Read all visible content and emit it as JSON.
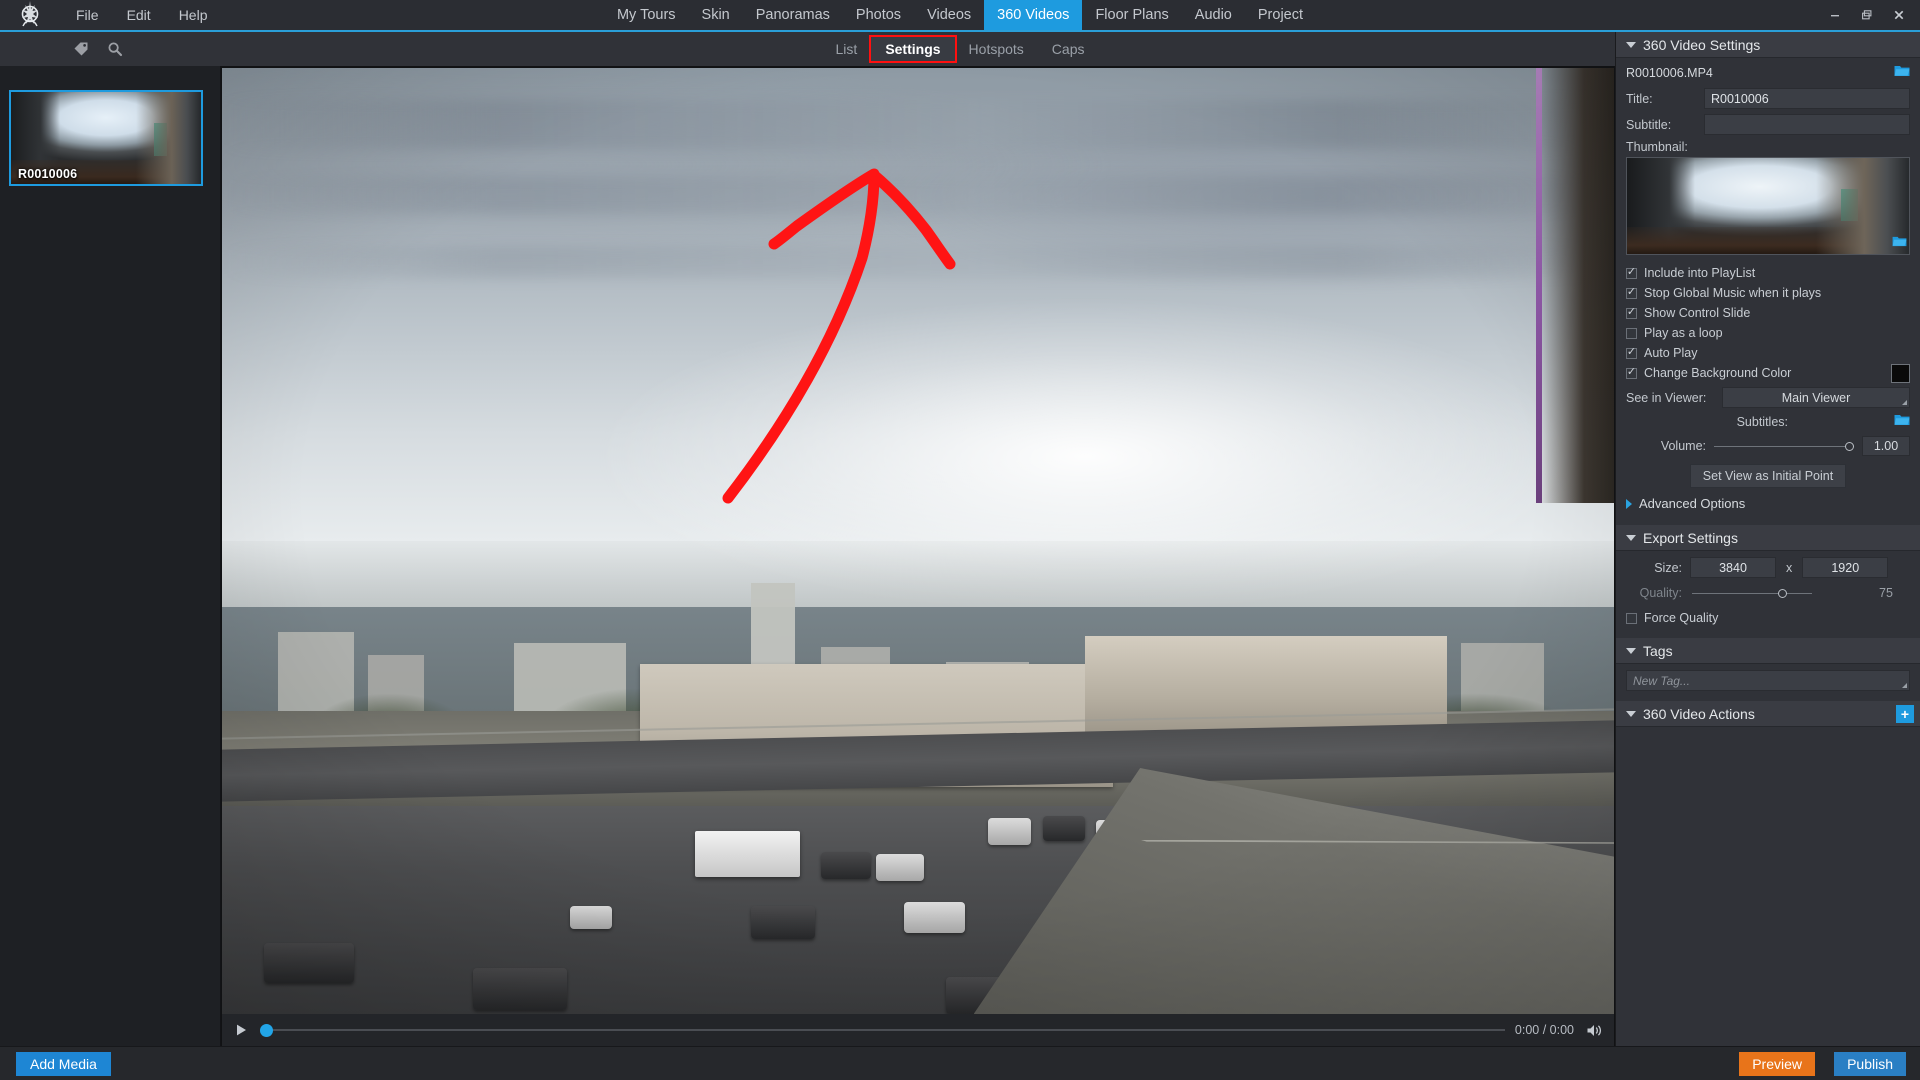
{
  "app": {
    "menus": [
      "File",
      "Edit",
      "Help"
    ],
    "toolbar_icons": [
      "tag-icon",
      "search-icon"
    ],
    "window_controls": {
      "minimize": "—",
      "restore": "❐",
      "close": "✕"
    }
  },
  "main_tabs": [
    {
      "label": "My Tours",
      "active": false
    },
    {
      "label": "Skin",
      "active": false
    },
    {
      "label": "Panoramas",
      "active": false
    },
    {
      "label": "Photos",
      "active": false
    },
    {
      "label": "Videos",
      "active": false
    },
    {
      "label": "360 Videos",
      "active": true
    },
    {
      "label": "Floor Plans",
      "active": false
    },
    {
      "label": "Audio",
      "active": false
    },
    {
      "label": "Project",
      "active": false
    }
  ],
  "sub_tabs": [
    {
      "label": "List",
      "active": false,
      "highlighted": false
    },
    {
      "label": "Settings",
      "active": true,
      "highlighted": true
    },
    {
      "label": "Hotspots",
      "active": false,
      "highlighted": false
    },
    {
      "label": "Caps",
      "active": false,
      "highlighted": false
    }
  ],
  "sidebar": {
    "items": [
      {
        "label": "R0010006",
        "selected": true
      }
    ]
  },
  "player": {
    "play_icon": "play-icon",
    "timecode": "0:00 / 0:00",
    "volume_icon": "volume-icon",
    "progress_percent": 0
  },
  "panel": {
    "video_settings": {
      "title": "360 Video Settings",
      "filename": "R0010006.MP4",
      "title_label": "Title:",
      "title_value": "R0010006",
      "subtitle_label": "Subtitle:",
      "subtitle_value": "",
      "thumbnail_label": "Thumbnail:",
      "checkboxes": [
        {
          "label": "Include into PlayList",
          "checked": true
        },
        {
          "label": "Stop Global Music when it plays",
          "checked": true
        },
        {
          "label": "Show Control Slide",
          "checked": true
        },
        {
          "label": "Play as a loop",
          "checked": false
        },
        {
          "label": "Auto Play",
          "checked": true
        },
        {
          "label": "Change Background Color",
          "checked": true
        }
      ],
      "background_color": "#0a0a0a",
      "see_in_viewer_label": "See in Viewer:",
      "see_in_viewer_value": "Main Viewer",
      "subtitles_label": "Subtitles:",
      "volume_label": "Volume:",
      "volume_value": "1.00",
      "volume_percent": 100,
      "set_view_button": "Set View as Initial Point",
      "advanced_options": "Advanced Options"
    },
    "export_settings": {
      "title": "Export Settings",
      "size_label": "Size:",
      "size_width": "3840",
      "size_separator": "x",
      "size_height": "1920",
      "quality_label": "Quality:",
      "quality_value": "75",
      "quality_percent": 75,
      "force_quality_label": "Force Quality",
      "force_quality_checked": false
    },
    "tags": {
      "title": "Tags",
      "placeholder": "New Tag..."
    },
    "actions": {
      "title": "360 Video Actions",
      "add_label": "+"
    }
  },
  "bottom": {
    "add_media": "Add Media",
    "preview": "Preview",
    "publish": "Publish"
  },
  "colors": {
    "accent_blue": "#1e9bdf",
    "preview_orange": "#e8741a",
    "publish_blue": "#2a7fc4",
    "annotation_red": "#ff1414"
  }
}
